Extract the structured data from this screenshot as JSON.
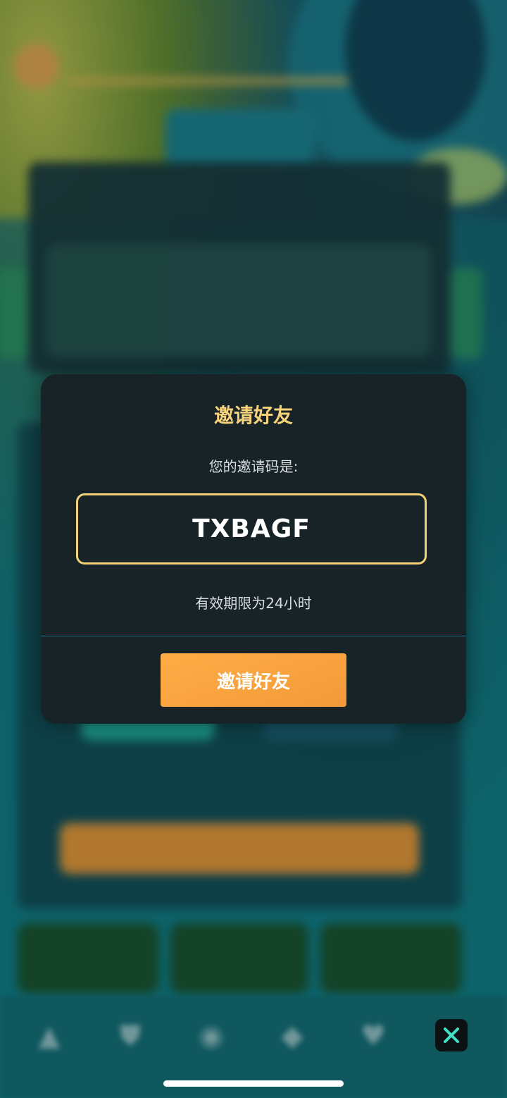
{
  "modal": {
    "title": "邀请好友",
    "subtitle": "您的邀请码是:",
    "invite_code": "TXBAGF",
    "validity_note": "有效期限为24小时",
    "invite_button": "邀请好友"
  },
  "overlay": {
    "close_icon": "close-icon"
  },
  "colors": {
    "modal_bg": "#172327",
    "title": "#f6d27b",
    "code_border": "#f3d27a",
    "button": "#f8a23e",
    "divider": "#1f6e86"
  }
}
